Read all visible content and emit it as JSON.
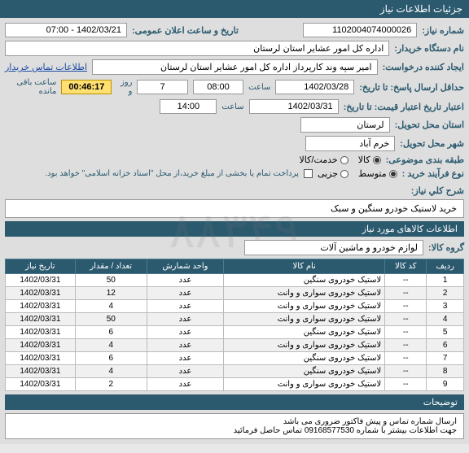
{
  "header": {
    "title": "جزئیات اطلاعات نیاز"
  },
  "fields": {
    "need_no_label": "شماره نیاز:",
    "need_no": "1102004074000026",
    "announce_label": "تاریخ و ساعت اعلان عمومی:",
    "announce": "1402/03/21 - 07:00",
    "buyer_org_label": "نام دستگاه خریدار:",
    "buyer_org": "اداره کل امور عشایر استان لرستان",
    "requester_label": "ایجاد کننده درخواست:",
    "requester": "امیر سپه وند کارپرداز اداره کل امور عشایر استان لرستان",
    "contact_link": "اطلاعات تماس خریدار",
    "deadline_label": "حداقل ارسال پاسخ: تا تاریخ:",
    "deadline_date": "1402/03/28",
    "time_label": "ساعت",
    "deadline_time": "08:00",
    "days_val": "7",
    "days_unit": "روز و",
    "countdown": "00:46:17",
    "countdown_unit": "ساعت باقی مانده",
    "validity_label": "اعتبار تاریخ اعتبار قیمت: تا تاریخ:",
    "validity_date": "1402/03/31",
    "validity_time": "14:00",
    "province_label": "استان محل تحویل:",
    "province": "لرستان",
    "city_label": "شهر محل تحویل:",
    "city": "خرم آباد",
    "category_label": "طبقه بندی موضوعی:",
    "cat_goods": "کالا",
    "cat_service": "خدمت/کالا",
    "buy_type_label": "نوع فرآیند خرید :",
    "bt_small": "متوسط",
    "bt_partial": "جزیی",
    "partial_note": "پرداخت تمام یا بخشی از مبلغ خرید،از محل \"اسناد خزانه اسلامی\" خواهد بود.",
    "summary_label": "شرح کلي نیاز:",
    "summary": "خرید لاستیک خودرو سنگین و سبک",
    "goods_section": "اطلاعات کالاهای مورد نیاز",
    "group_label": "گروه کالا:",
    "group": "لوازم خودرو و ماشین آلات",
    "notes_section": "توضیحات",
    "note1": "ارسال شماره تماس و پیش فاکتور ضروری می باشد",
    "note2": "جهت اطلاعات بیشتر با شماره 09168577530 تماس حاصل فرمائید"
  },
  "table": {
    "headers": [
      "ردیف",
      "کد کالا",
      "نام کالا",
      "واحد شمارش",
      "تعداد / مقدار",
      "تاریخ نیاز"
    ],
    "rows": [
      [
        "1",
        "--",
        "لاستیک خودروی سنگین",
        "عدد",
        "50",
        "1402/03/31"
      ],
      [
        "2",
        "--",
        "لاستیک خودروی سواری و وانت",
        "عدد",
        "12",
        "1402/03/31"
      ],
      [
        "3",
        "--",
        "لاستیک خودروی سواری و وانت",
        "عدد",
        "4",
        "1402/03/31"
      ],
      [
        "4",
        "--",
        "لاستیک خودروی سواری و وانت",
        "عدد",
        "50",
        "1402/03/31"
      ],
      [
        "5",
        "--",
        "لاستیک خودروی سنگین",
        "عدد",
        "6",
        "1402/03/31"
      ],
      [
        "6",
        "--",
        "لاستیک خودروی سواری و وانت",
        "عدد",
        "4",
        "1402/03/31"
      ],
      [
        "7",
        "--",
        "لاستیک خودروی سنگین",
        "عدد",
        "6",
        "1402/03/31"
      ],
      [
        "8",
        "--",
        "لاستیک خودروی سنگین",
        "عدد",
        "4",
        "1402/03/31"
      ],
      [
        "9",
        "--",
        "لاستیک خودروی سواری و وانت",
        "عدد",
        "2",
        "1402/03/31"
      ]
    ]
  }
}
